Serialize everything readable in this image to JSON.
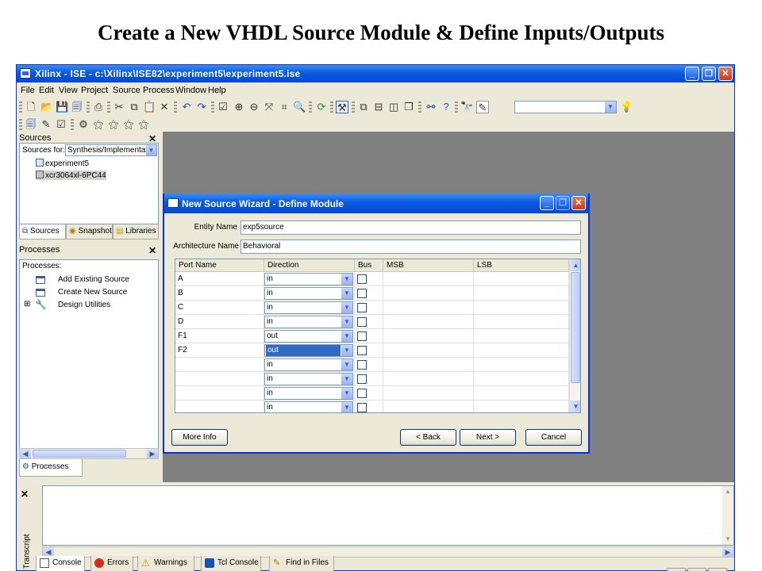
{
  "slide_title": "Create a New VHDL Source Module & Define Inputs/Outputs",
  "window": {
    "title": "Xilinx - ISE - c:\\Xilinx\\ISE82\\experiment5\\experiment5.ise",
    "controls": {
      "minimize": "_",
      "restore": "❐",
      "close": "✕"
    }
  },
  "menu": [
    "File",
    "Edit",
    "View",
    "Project",
    "Source",
    "Process",
    "Window",
    "Help"
  ],
  "toolbar": {
    "search_combo_value": ""
  },
  "sources_pane": {
    "title": "Sources",
    "close": "✕",
    "sources_for_label": "Sources for:",
    "sources_for_value": "Synthesis/Implementation",
    "tree": [
      "experiment5",
      "xcr3064xl-6PC44"
    ],
    "tabs": [
      "Sources",
      "Snapshots",
      "Libraries"
    ]
  },
  "processes_pane": {
    "title": "Processes",
    "close": "✕",
    "list_label": "Processes:",
    "items": [
      "Add Existing Source",
      "Create New Source",
      "Design Utilities"
    ],
    "expand": "⊞",
    "tab": "Processes"
  },
  "transcript": {
    "close": "✕",
    "label": "Transcript",
    "tabs": [
      "Console",
      "Errors",
      "Warnings",
      "Tcl Console",
      "Find in Files"
    ]
  },
  "dialog": {
    "title": "New Source Wizard - Define Module",
    "entity_label": "Entity Name",
    "entity_value": "exp5source",
    "arch_label": "Architecture Name",
    "arch_value": "Behavioral",
    "columns": [
      "Port Name",
      "Direction",
      "Bus",
      "MSB",
      "LSB"
    ],
    "ports": [
      {
        "name": "A",
        "direction": "in"
      },
      {
        "name": "B",
        "direction": "in"
      },
      {
        "name": "C",
        "direction": "in"
      },
      {
        "name": "D",
        "direction": "in"
      },
      {
        "name": "F1",
        "direction": "out"
      },
      {
        "name": "F2",
        "direction": "out"
      },
      {
        "name": "",
        "direction": "in"
      },
      {
        "name": "",
        "direction": "in"
      },
      {
        "name": "",
        "direction": "in"
      },
      {
        "name": "",
        "direction": "in"
      }
    ],
    "buttons": {
      "more_info": "More Info",
      "back": "< Back",
      "next": "Next >",
      "cancel": "Cancel"
    }
  }
}
